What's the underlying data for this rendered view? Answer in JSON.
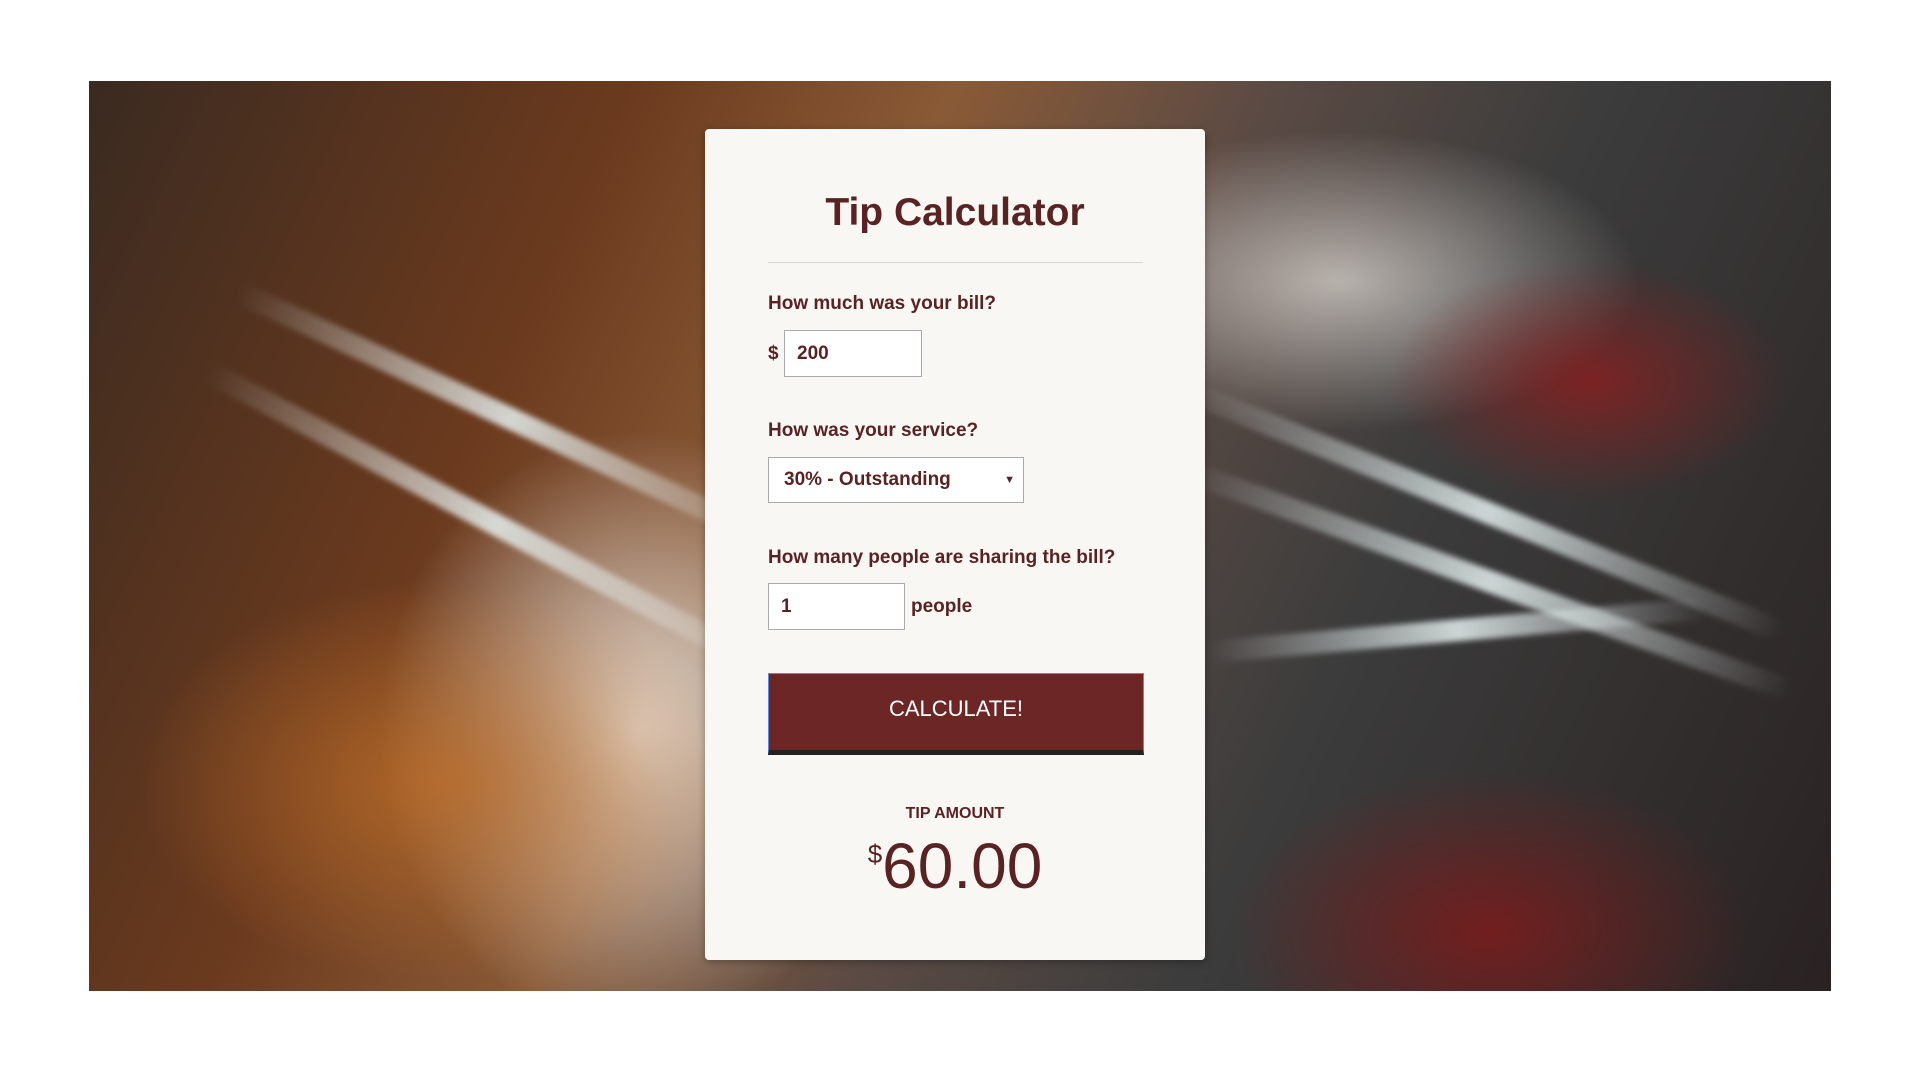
{
  "title": "Tip Calculator",
  "bill": {
    "label": "How much was your bill?",
    "currency": "$",
    "value": "200"
  },
  "service": {
    "label": "How was your service?",
    "selected": "30% - Outstanding"
  },
  "people": {
    "label": "How many people are sharing the bill?",
    "value": "1",
    "unit": "people"
  },
  "calculate_label": "CALCULATE!",
  "result": {
    "label": "TIP AMOUNT",
    "currency": "$",
    "amount": "60.00"
  },
  "colors": {
    "accent": "#6d2626",
    "text": "#5a2323"
  }
}
